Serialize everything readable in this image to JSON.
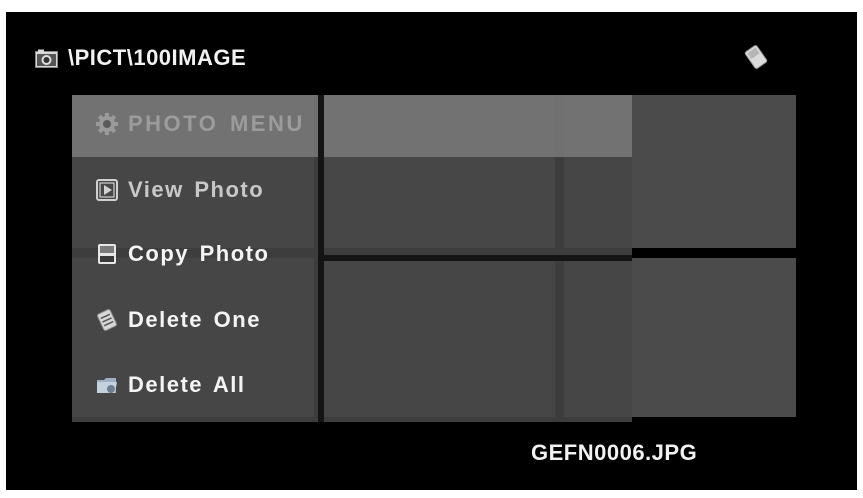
{
  "header": {
    "folder_path": "\\PICT\\100IMAGE",
    "left_icon": "camera-icon",
    "right_icon": "memory-card-icon"
  },
  "menu": {
    "title": "PHOTO MENU",
    "title_icon": "gear-icon",
    "items": [
      {
        "label": "View Photo",
        "icon": "play-icon"
      },
      {
        "label": "Copy Photo",
        "icon": "card-copy-icon"
      },
      {
        "label": "Delete One",
        "icon": "delete-one-icon"
      },
      {
        "label": "Delete All",
        "icon": "folder-delete-icon"
      }
    ]
  },
  "footer": {
    "filename": "GEFN0006.JPG"
  }
}
